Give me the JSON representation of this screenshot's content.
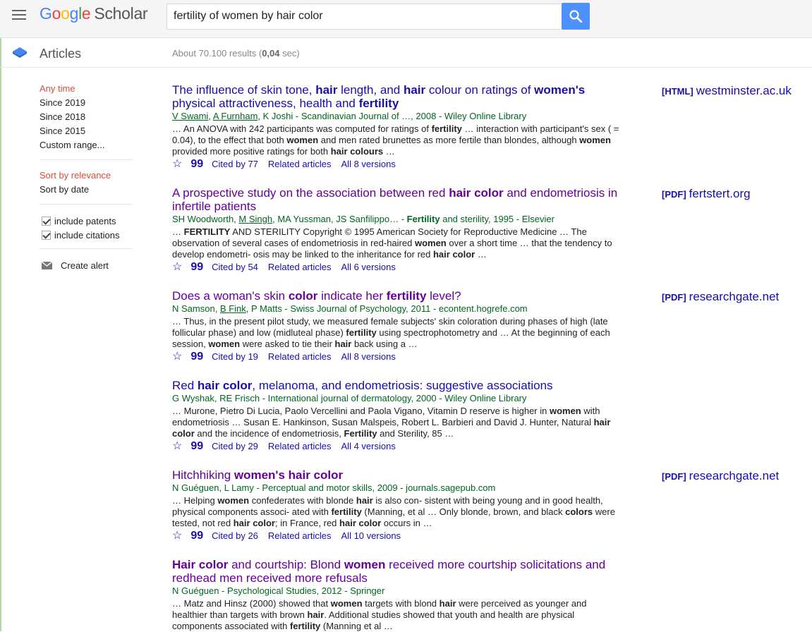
{
  "header": {
    "logo_letters": [
      {
        "ch": "G",
        "color": "#4285f4"
      },
      {
        "ch": "o",
        "color": "#ea4335"
      },
      {
        "ch": "o",
        "color": "#fbbc05"
      },
      {
        "ch": "g",
        "color": "#4285f4"
      },
      {
        "ch": "l",
        "color": "#34a853"
      },
      {
        "ch": "e",
        "color": "#ea4335"
      }
    ],
    "logo_suffix": "Scholar",
    "search_value": "fertility of women by hair color",
    "search_icon": "search-icon",
    "menu_icon": "hamburger-menu-icon"
  },
  "subbar": {
    "section": "Articles",
    "results_prefix": "About 70.100 results (",
    "results_time": "0,04",
    "results_suffix": " sec)"
  },
  "sidebar": {
    "time_filters": [
      "Any time",
      "Since 2019",
      "Since 2018",
      "Since 2015",
      "Custom range..."
    ],
    "sort_options": [
      "Sort by relevance",
      "Sort by date"
    ],
    "checkboxes": [
      "include patents",
      "include citations"
    ],
    "alert_label": "Create alert"
  },
  "colors": {
    "link": "#1a0dab",
    "visited": "#660099",
    "green": "#006621",
    "active": "#dd4b39",
    "button": "#4d90fe"
  },
  "results": [
    {
      "title_html": "The influence of skin tone, <b>hair</b> length, and <b>hair</b> colour on ratings of <b>women's</b> physical attractiveness, health and <b>fertility</b>",
      "visited": false,
      "authors_html": "<u>V Swami</u>, <u>A Furnham</u>, K Joshi - Scandinavian Journal of …, 2008 - Wiley Online Library",
      "snippet_html": "… An ANOVA with 242 participants was computed for ratings of <b>fertility</b> … interaction with participant's sex ( = 0.04), to the effect that both <b>women</b> and men rated brunettes as more fertile than blondes, although <b>women</b> provided more positive ratings for both <b>hair colours</b> …",
      "cited": "Cited by 77",
      "related": "Related articles",
      "versions": "All 8 versions",
      "side_tag": "[HTML]",
      "side_domain": "westminster.ac.uk"
    },
    {
      "title_html": "A prospective study on the association between red <b>hair color</b> and endometriosis in infertile patients",
      "visited": true,
      "authors_html": "SH Woodworth, <u>M Singh</u>, MA Yussman, JS Sanfilippo… - <b>Fertility</b> and sterility, 1995 - Elsevier",
      "snippet_html": "… <b>FERTILITY</b> AND STERILITY Copyright © 1995 American Society for Reproductive Medicine … The observation of several cases of endometriosis in red-haired <b>women</b> over a short time … that the tendency to develop endometri- osis may be linked to the inheritance for red <b>hair color</b> …",
      "cited": "Cited by 54",
      "related": "Related articles",
      "versions": "All 6 versions",
      "side_tag": "[PDF]",
      "side_domain": "fertstert.org"
    },
    {
      "title_html": "Does a woman's skin <b>color</b> indicate her <b>fertility</b> level?",
      "visited": true,
      "authors_html": "N Samson, <u>B Fink</u>, P Matts - Swiss Journal of Psychology, 2011 - econtent.hogrefe.com",
      "snippet_html": "… Thus, in the present pilot study, we measured female subjects' skin coloration during phases of high (late follicular phase) and low (midluteal phase) <b>fertility</b> using spectrophotometry and … At the beginning of each session, <b>women</b> were asked to tie their <b>hair</b> back using a …",
      "cited": "Cited by 19",
      "related": "Related articles",
      "versions": "All 8 versions",
      "side_tag": "[PDF]",
      "side_domain": "researchgate.net"
    },
    {
      "title_html": "Red <b>hair color</b>, melanoma, and endometriosis: suggestive associations",
      "visited": false,
      "authors_html": "G Wyshak, RE Frisch - International journal of dermatology, 2000 - Wiley Online Library",
      "snippet_html": "… Murone, Pietro Di Lucia, Paolo Vercellini and Paola Vigano, Vitamin D reserve is higher in <b>women</b> with endometriosis … Susan E. Hankinson, Susan Malspeis, Robert L. Barbieri and David J. Hunter, Natural <b>hair color</b> and the incidence of endometriosis, <b>Fertility</b> and Sterility, 85 …",
      "cited": "Cited by 29",
      "related": "Related articles",
      "versions": "All 4 versions",
      "side_tag": "",
      "side_domain": ""
    },
    {
      "title_html": "Hitchhiking <b>women's hair color</b>",
      "visited": true,
      "authors_html": "N Guéguen, L Lamy - Perceptual and motor skills, 2009 - journals.sagepub.com",
      "snippet_html": "… Helping <b>women</b> confederates with blonde <b>hair</b> is also con- sistent with being young and in good health, physical components associ- ated with <b>fertility</b> (Manning, et al … Only blonde, brown, and black <b>colors</b> were tested, not red <b>hair color</b>; in France, red <b>hair color</b> occurs in …",
      "cited": "Cited by 26",
      "related": "Related articles",
      "versions": "All 10 versions",
      "side_tag": "[PDF]",
      "side_domain": "researchgate.net"
    },
    {
      "title_html": "<b>Hair color</b> and courtship: Blond <b>women</b> received more courtship solicitations and redhead men received more refusals",
      "visited": true,
      "authors_html": "N Guéguen - Psychological Studies, 2012 - Springer",
      "snippet_html": "… Matz and Hinsz (2000) showed that <b>women</b> targets with blond <b>hair</b> were perceived as younger and healthier than targets with brown <b>hair</b>. Additional studies showed that youth and health are physical components associated with <b>fertility</b> (Manning et al …",
      "cited": "",
      "related": "",
      "versions": "",
      "side_tag": "",
      "side_domain": ""
    }
  ]
}
